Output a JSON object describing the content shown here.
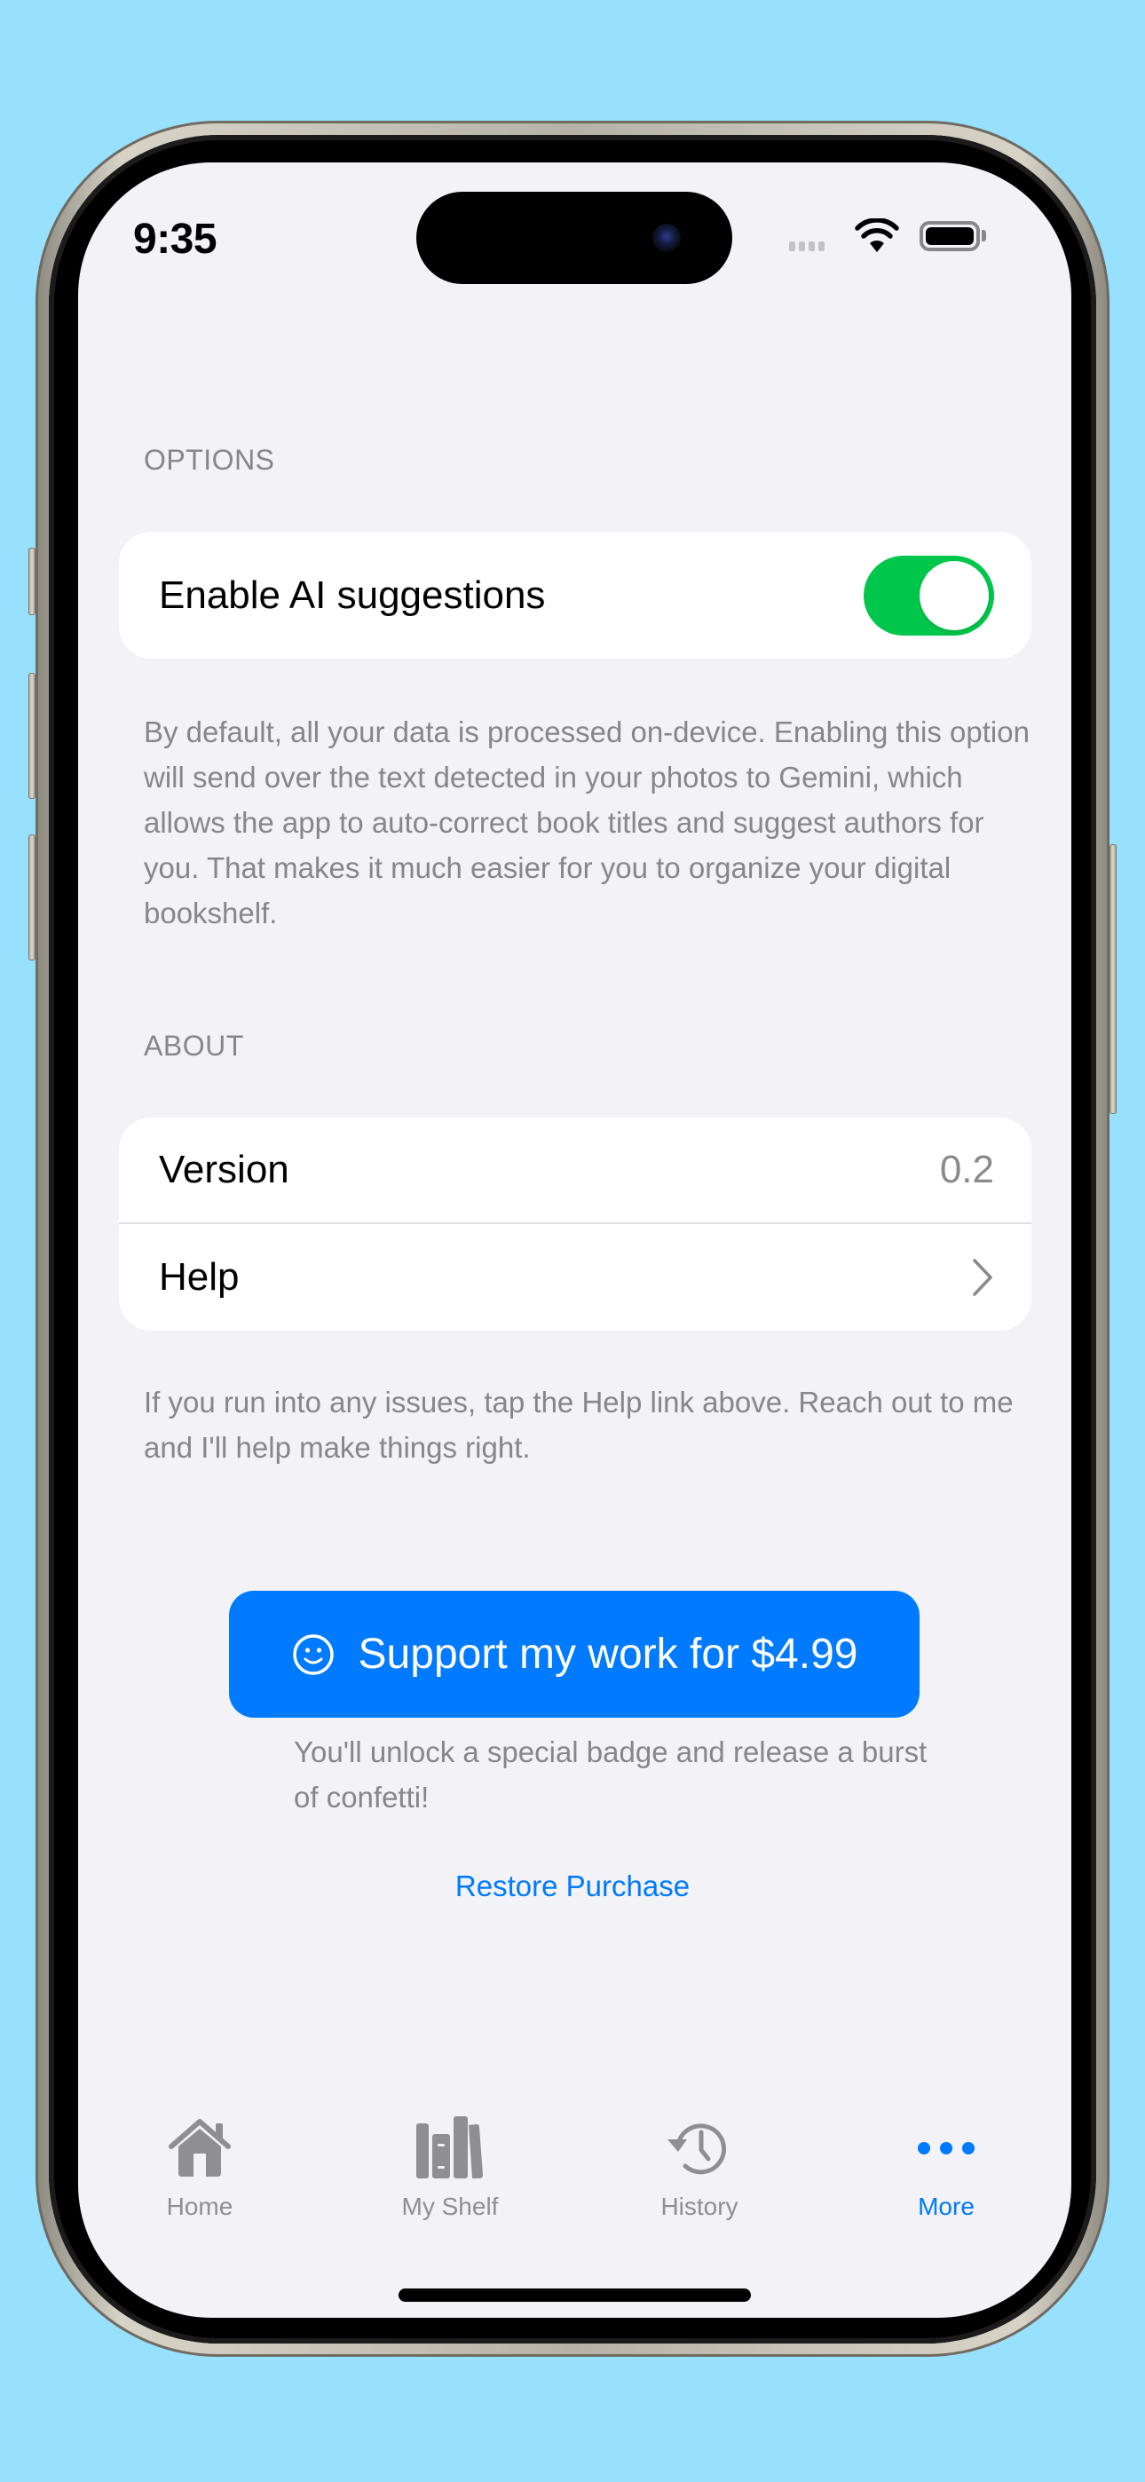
{
  "colors": {
    "background": "#97e1fe",
    "screen_background": "#f2f2f7",
    "accent": "#007aff",
    "toggle_on": "#00c74b",
    "secondary_text": "#86868b"
  },
  "status_bar": {
    "time": "9:35",
    "icons": [
      "cellular-signal-icon",
      "wifi-icon",
      "battery-icon"
    ]
  },
  "options_section": {
    "header": "OPTIONS",
    "rows": [
      {
        "label": "Enable AI suggestions",
        "type": "toggle",
        "value": true
      }
    ],
    "footer": "By default, all your data is processed on-device. Enabling this option will send over the text detected in your photos to Gemini, which allows the app to auto-correct book titles and suggest authors for you. That makes it much easier for you to organize your digital bookshelf."
  },
  "about_section": {
    "header": "ABOUT",
    "rows": [
      {
        "label": "Version",
        "value": "0.2"
      },
      {
        "label": "Help",
        "accessory": "chevron-right-icon"
      }
    ],
    "footer": "If you run into any issues, tap the Help link above. Reach out to me and I'll help make things right."
  },
  "support": {
    "button_label": "Support my work for $4.99",
    "button_icon": "smiley-face-icon",
    "note": "You'll unlock a special badge and release a burst of confetti!",
    "restore_label": "Restore Purchase"
  },
  "tab_bar": {
    "items": [
      {
        "label": "Home",
        "icon": "house-icon",
        "active": false
      },
      {
        "label": "My Shelf",
        "icon": "books-icon",
        "active": false
      },
      {
        "label": "History",
        "icon": "history-clock-icon",
        "active": false
      },
      {
        "label": "More",
        "icon": "ellipsis-icon",
        "active": true
      }
    ]
  }
}
